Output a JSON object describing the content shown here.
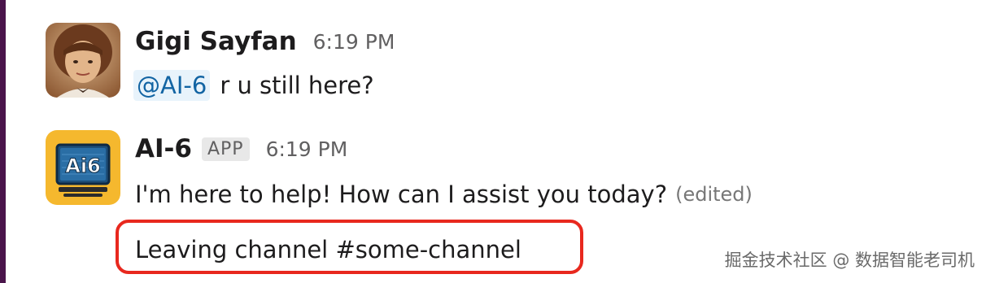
{
  "messages": [
    {
      "sender": "Gigi Sayfan",
      "time": "6:19 PM",
      "mention": "@AI-6",
      "text": "r u still here?",
      "avatar": "user-photo-avatar"
    },
    {
      "sender": "AI-6",
      "badge": "APP",
      "time": "6:19 PM",
      "text": "I'm here to help! How can I assist you today?",
      "edited": "(edited)",
      "avatar": "ai6-app-icon",
      "avatar_text": "Ai6"
    }
  ],
  "leave_notice": "Leaving channel #some-channel",
  "watermark": "掘金技术社区 @ 数据智能老司机",
  "colors": {
    "sidebar_accent": "#4a154b",
    "mention": "#1264a3",
    "highlight_box": "#e8281e",
    "app_icon_bg": "#f5b82e",
    "app_icon_screen": "#1d4f7a"
  }
}
